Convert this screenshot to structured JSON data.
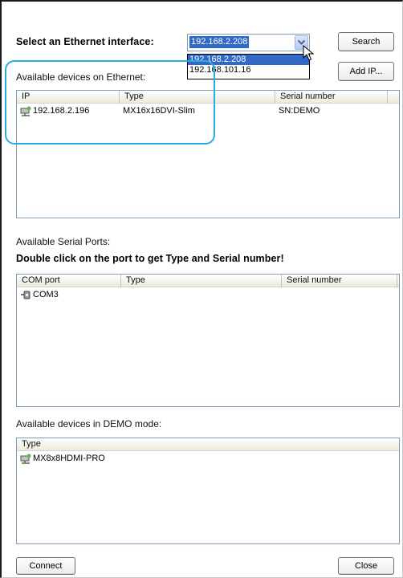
{
  "ethernet": {
    "select_label": "Select an Ethernet interface:",
    "selected_interface": "192.168.2.208",
    "interface_options": [
      "192.168.2.208",
      "192.168.101.16"
    ],
    "search_button": "Search",
    "add_ip_button": "Add IP...",
    "available_label": "Available devices on Ethernet:",
    "columns": [
      "IP",
      "Type",
      "Serial number"
    ],
    "devices": [
      {
        "ip": "192.168.2.196",
        "type": "MX16x16DVI-Slim",
        "serial": "SN:DEMO",
        "icon": "network-device-icon"
      }
    ]
  },
  "serial": {
    "available_label": "Available Serial Ports:",
    "instruction": "Double click on the port to get Type and Serial number!",
    "columns": [
      "COM port",
      "Type",
      "Serial number"
    ],
    "ports": [
      {
        "port": "COM3",
        "type": "",
        "serial": "",
        "icon": "serial-port-icon"
      }
    ]
  },
  "demo": {
    "available_label": "Available devices in DEMO mode:",
    "columns": [
      "Type"
    ],
    "devices": [
      {
        "type": "MX8x8HDMI-PRO",
        "icon": "network-device-icon"
      }
    ]
  },
  "footer": {
    "connect_button": "Connect",
    "close_button": "Close"
  },
  "colors": {
    "selection": "#316ac5",
    "highlight_annotation": "#29abe2",
    "list_border": "#7f9db9"
  }
}
